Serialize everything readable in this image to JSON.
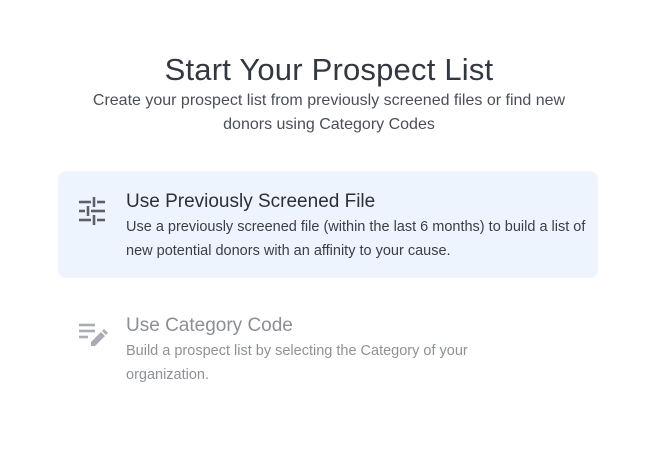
{
  "header": {
    "title": "Start Your Prospect List",
    "subtitle": "Create your prospect list from previously screened files or find new donors using Category Codes"
  },
  "options": [
    {
      "title": "Use Previously Screened File",
      "description": "Use a previously screened file (within the last 6 months) to build a list of new potential donors with an affinity to your cause.",
      "icon": "tune-sliders-icon",
      "selected": true
    },
    {
      "title": "Use Category Code",
      "description": "Build a prospect list by selecting the Category of your organization.",
      "icon": "edit-list-icon",
      "selected": false
    }
  ],
  "colors": {
    "selected_background": "#eef4fd",
    "selected_text": "#2b2f36",
    "unselected_text": "#8b8f95",
    "icon_selected": "#5b6068",
    "icon_unselected": "#a9adb3"
  }
}
